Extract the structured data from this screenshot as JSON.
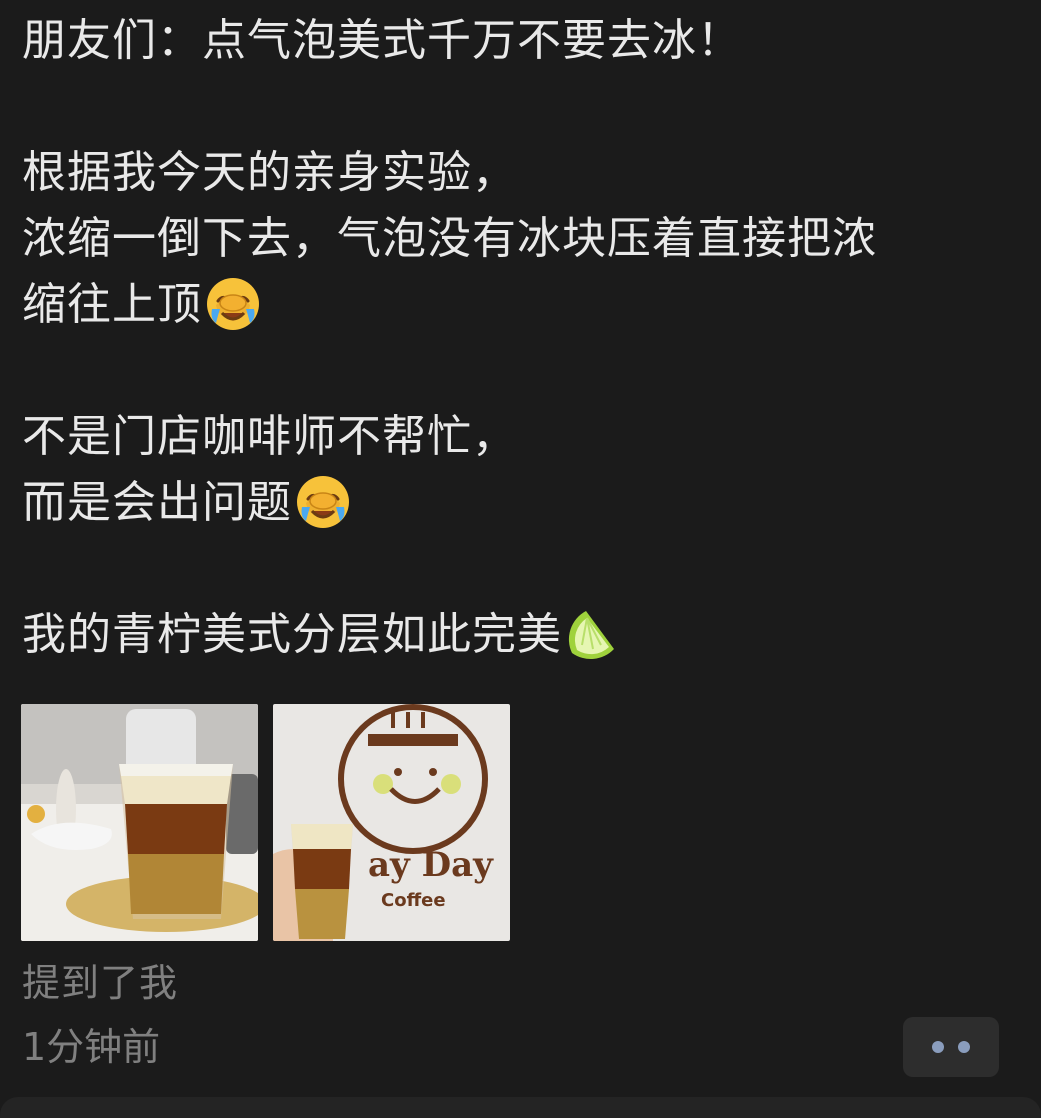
{
  "post": {
    "lines": [
      "朋友们：点气泡美式千万不要去冰！",
      "",
      "根据我今天的亲身实验，",
      "浓缩一倒下去，气泡没有冰块压着直接把浓",
      "缩往上顶",
      "",
      "不是门店咖啡师不帮忙，",
      "而是会出问题",
      "",
      "我的青柠美式分层如此完美"
    ],
    "emojis": [
      "face-palm-crying-icon",
      "face-palm-crying-icon",
      "lime-icon"
    ]
  },
  "photos": {
    "photo_2_sign_text": "ay Day",
    "photo_2_sign_subtext": "Coffee"
  },
  "meta": {
    "mention": "提到了我",
    "time": "1分钟前"
  },
  "colors": {
    "background": "#1b1b1b",
    "text": "#e9e9e9",
    "secondary_text": "#808080",
    "dots": "#8a9dbd"
  }
}
